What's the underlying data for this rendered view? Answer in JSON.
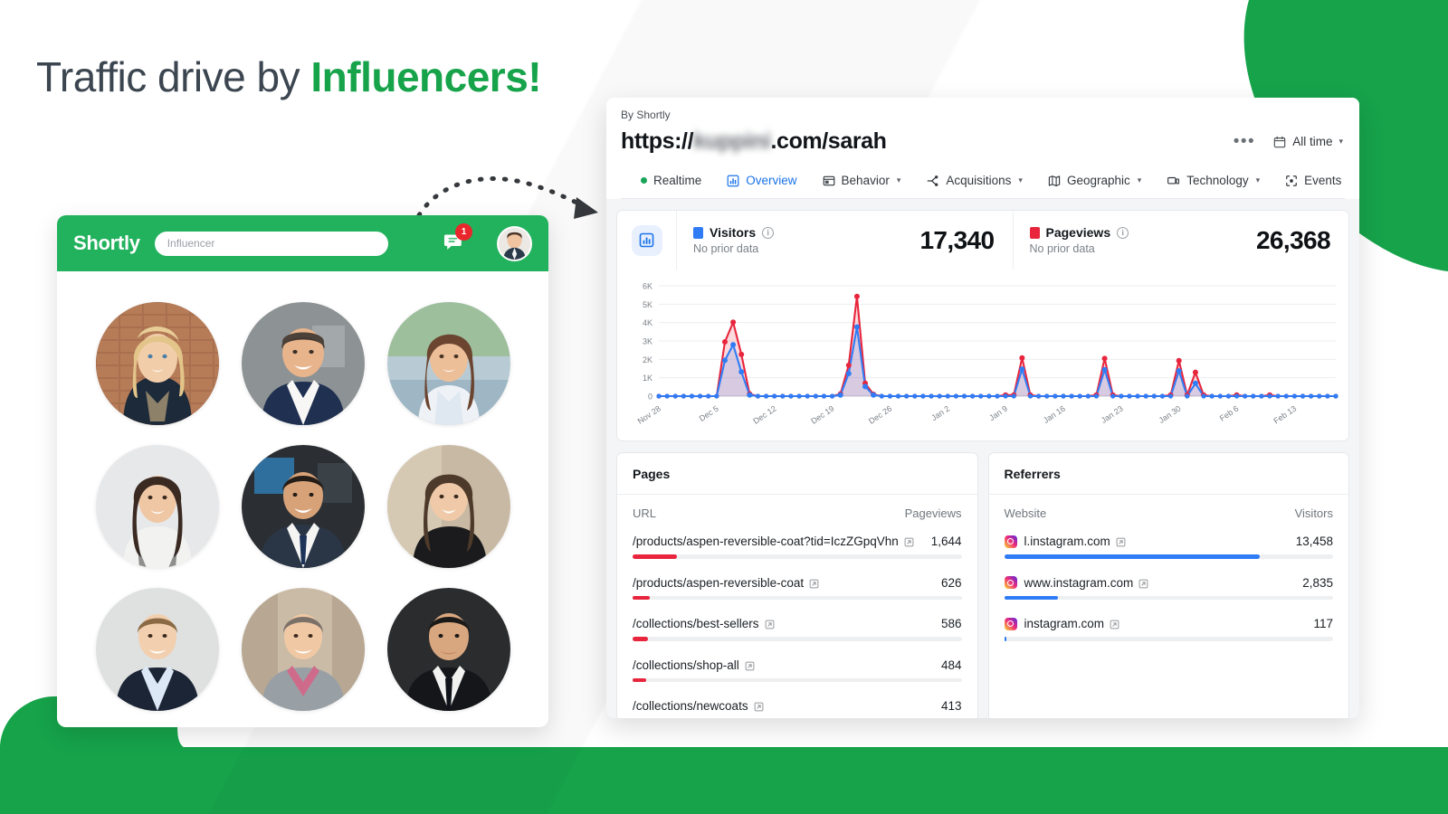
{
  "theme": {
    "green": "#16a34a",
    "header_green": "#22b15c",
    "blue": "#1a73e8",
    "red": "#e8262b",
    "visitors_color": "#2f7cf6",
    "pageviews_color": "#e8253c"
  },
  "headline": {
    "part1": "Traffic drive by ",
    "part2": "Influencers!"
  },
  "left_panel": {
    "brand": "Shortly",
    "search_value": "Influencer",
    "notification_count": "1",
    "icons": {
      "chat": "chat-icon",
      "avatar": "user-avatar"
    }
  },
  "dashboard": {
    "by_line": "By Shortly",
    "url_prefix": "https://",
    "url_blurred": "kuppini",
    "url_suffix": ".com/sarah",
    "more_label": "•••",
    "date_range": "All time",
    "tabs": [
      {
        "label": "Realtime",
        "icon": "live-dot-icon",
        "active": false,
        "chevron": false
      },
      {
        "label": "Overview",
        "icon": "bar-chart-icon",
        "active": true,
        "chevron": false
      },
      {
        "label": "Behavior",
        "icon": "window-icon",
        "active": false,
        "chevron": true
      },
      {
        "label": "Acquisitions",
        "icon": "branch-icon",
        "active": false,
        "chevron": true
      },
      {
        "label": "Geographic",
        "icon": "map-icon",
        "active": false,
        "chevron": true
      },
      {
        "label": "Technology",
        "icon": "device-icon",
        "active": false,
        "chevron": true
      },
      {
        "label": "Events",
        "icon": "target-icon",
        "active": false,
        "chevron": false
      }
    ],
    "stats": [
      {
        "title": "Visitors",
        "sub": "No prior data",
        "value": "17,340",
        "color": "#2f7cf6"
      },
      {
        "title": "Pageviews",
        "sub": "No prior data",
        "value": "26,368",
        "color": "#e8253c"
      }
    ],
    "pages_panel": {
      "title": "Pages",
      "col_url": "URL",
      "col_metric": "Pageviews",
      "rows": [
        {
          "label": "/products/aspen-reversible-coat?tid=IczZGpqVhn",
          "value": "1,644",
          "pct": 13.5
        },
        {
          "label": "/products/aspen-reversible-coat",
          "value": "626",
          "pct": 5.2
        },
        {
          "label": "/collections/best-sellers",
          "value": "586",
          "pct": 4.8
        },
        {
          "label": "/collections/shop-all",
          "value": "484",
          "pct": 4.0
        },
        {
          "label": "/collections/newcoats",
          "value": "413",
          "pct": 3.4
        }
      ]
    },
    "referrers_panel": {
      "title": "Referrers",
      "col_site": "Website",
      "col_metric": "Visitors",
      "rows": [
        {
          "label": "l.instagram.com",
          "value": "13,458",
          "pct": 77.6,
          "icon": "instagram-icon"
        },
        {
          "label": "www.instagram.com",
          "value": "2,835",
          "pct": 16.4,
          "icon": "instagram-icon"
        },
        {
          "label": "instagram.com",
          "value": "117",
          "pct": 0.7,
          "icon": "instagram-icon"
        }
      ]
    }
  },
  "chart_data": {
    "type": "line",
    "title": "",
    "xlabel": "",
    "ylabel": "",
    "ylim": [
      0,
      6000
    ],
    "yticks": [
      0,
      1000,
      2000,
      3000,
      4000,
      5000,
      6000
    ],
    "ytick_labels": [
      "0",
      "1K",
      "2K",
      "3K",
      "4K",
      "5K",
      "6K"
    ],
    "grid": true,
    "legend": [
      "Visitors",
      "Pageviews"
    ],
    "x_tick_labels": [
      "Nov 28",
      "Dec 5",
      "Dec 12",
      "Dec 19",
      "Dec 26",
      "Jan 2",
      "Jan 9",
      "Jan 16",
      "Jan 23",
      "Jan 30",
      "Feb 6",
      "Feb 13"
    ],
    "x_tick_indices": [
      0,
      7,
      14,
      21,
      28,
      35,
      42,
      49,
      56,
      63,
      70,
      77
    ],
    "series": [
      {
        "name": "Visitors",
        "color": "#2f7cf6",
        "values": [
          0,
          0,
          0,
          0,
          0,
          0,
          0,
          0,
          1950,
          2800,
          1320,
          60,
          0,
          0,
          0,
          0,
          0,
          0,
          0,
          0,
          0,
          0,
          60,
          1230,
          3760,
          520,
          60,
          0,
          0,
          0,
          0,
          0,
          0,
          0,
          0,
          0,
          0,
          0,
          0,
          0,
          0,
          0,
          0,
          0,
          1470,
          0,
          0,
          0,
          0,
          0,
          0,
          0,
          0,
          0,
          1440,
          0,
          0,
          0,
          0,
          0,
          0,
          0,
          0,
          1370,
          0,
          700,
          0,
          0,
          0,
          0,
          0,
          0,
          0,
          0,
          0,
          0,
          0,
          0,
          0,
          0,
          0,
          0,
          0
        ]
      },
      {
        "name": "Pageviews",
        "color": "#e8253c",
        "values": [
          0,
          0,
          0,
          0,
          0,
          0,
          0,
          0,
          2950,
          4020,
          2270,
          120,
          0,
          0,
          0,
          0,
          0,
          0,
          0,
          0,
          0,
          0,
          120,
          1680,
          5420,
          700,
          100,
          0,
          0,
          0,
          0,
          0,
          0,
          0,
          0,
          0,
          0,
          0,
          0,
          0,
          0,
          0,
          60,
          60,
          2080,
          60,
          0,
          0,
          0,
          0,
          0,
          0,
          0,
          60,
          2050,
          60,
          0,
          0,
          0,
          0,
          0,
          0,
          60,
          1930,
          60,
          1300,
          60,
          0,
          0,
          0,
          60,
          0,
          0,
          0,
          60,
          0,
          0,
          0,
          0,
          0,
          0,
          0,
          0
        ]
      }
    ]
  }
}
